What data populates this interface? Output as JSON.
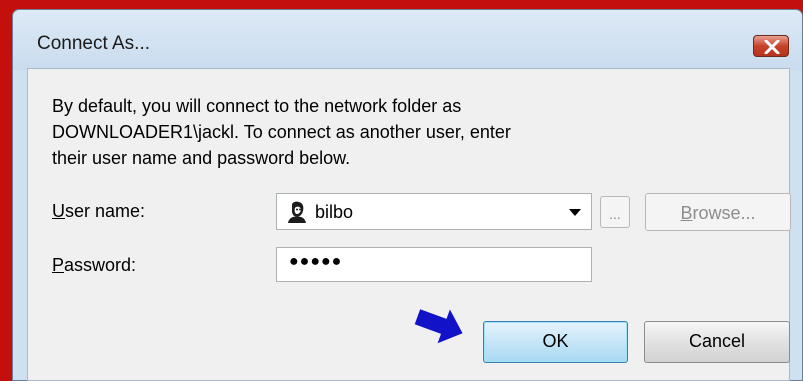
{
  "dialog": {
    "title": "Connect As...",
    "message_lines": [
      "By default, you will connect to the network folder as",
      "DOWNLOADER1\\jackl. To connect as another user, enter",
      "their user name and password below."
    ]
  },
  "form": {
    "username_label_accel": "U",
    "username_label_rest": "ser name:",
    "username_value": "bilbo",
    "password_label_accel": "P",
    "password_label_rest": "assword:",
    "password_mask": "●●●●●"
  },
  "buttons": {
    "ellipsis_label": "...",
    "browse_accel": "B",
    "browse_rest": "rowse...",
    "ok_label": "OK",
    "cancel_label": "Cancel"
  },
  "colors": {
    "background": "#c4100c",
    "pointer_arrow": "#1212c8"
  },
  "icons": {
    "close": "close-icon",
    "user": "user-icon",
    "dropdown": "dropdown-arrow-icon",
    "pointer": "pointer-arrow-icon"
  }
}
